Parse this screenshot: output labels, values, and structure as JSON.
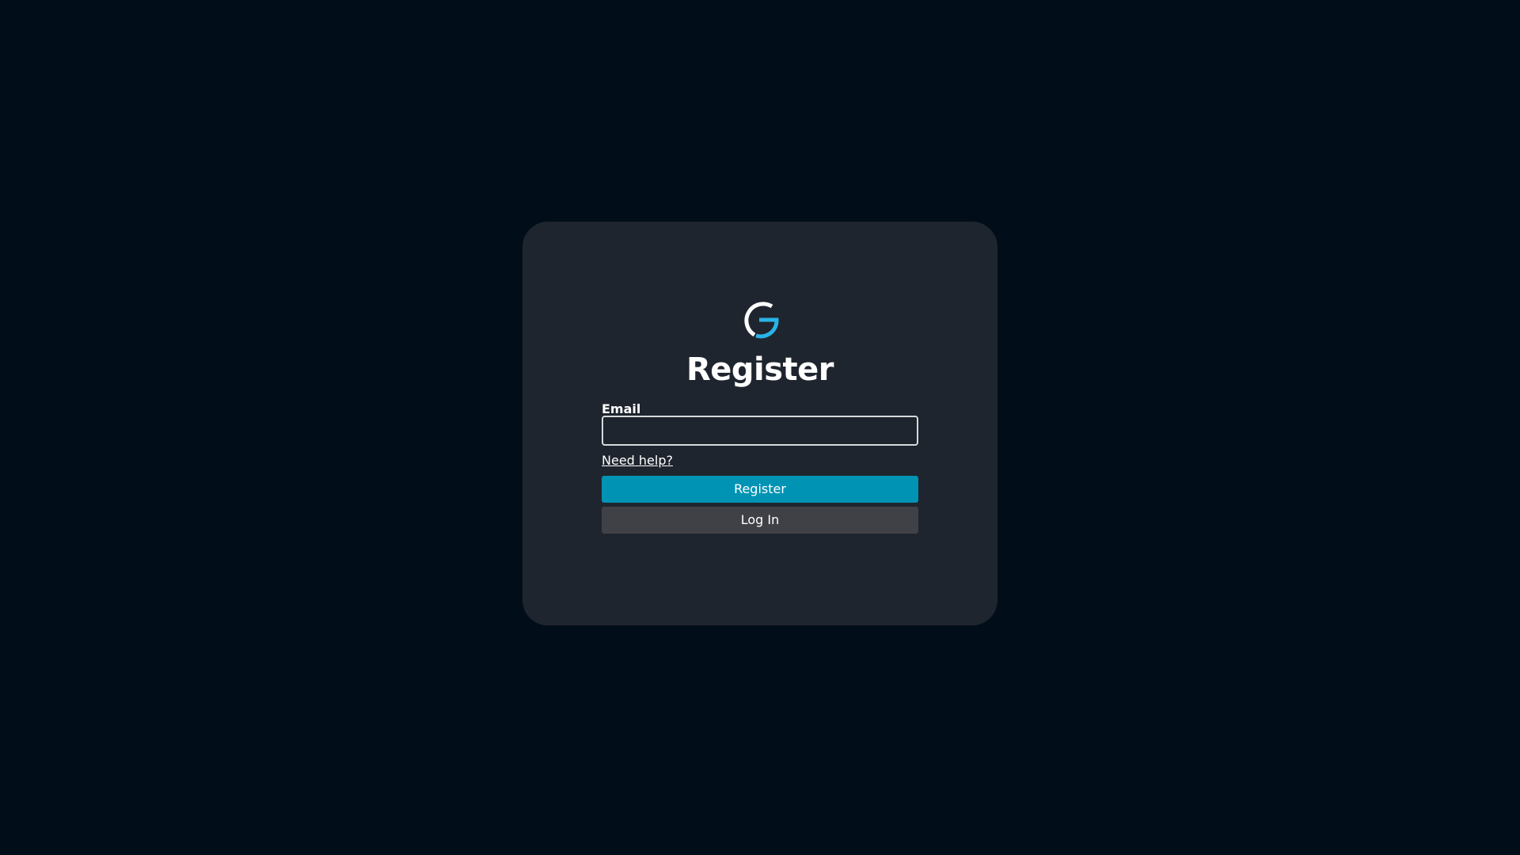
{
  "page": {
    "title": "Register"
  },
  "form": {
    "email_label": "Email",
    "email_value": "",
    "help_link": "Need help?",
    "register_button": "Register",
    "login_button": "Log In"
  },
  "colors": {
    "background": "#010d19",
    "card": "#1f252e",
    "primary": "#0093b4",
    "secondary": "#404146",
    "logo_accent": "#29b3e8",
    "text": "#ffffff"
  },
  "icons": {
    "logo": "logo-icon"
  }
}
